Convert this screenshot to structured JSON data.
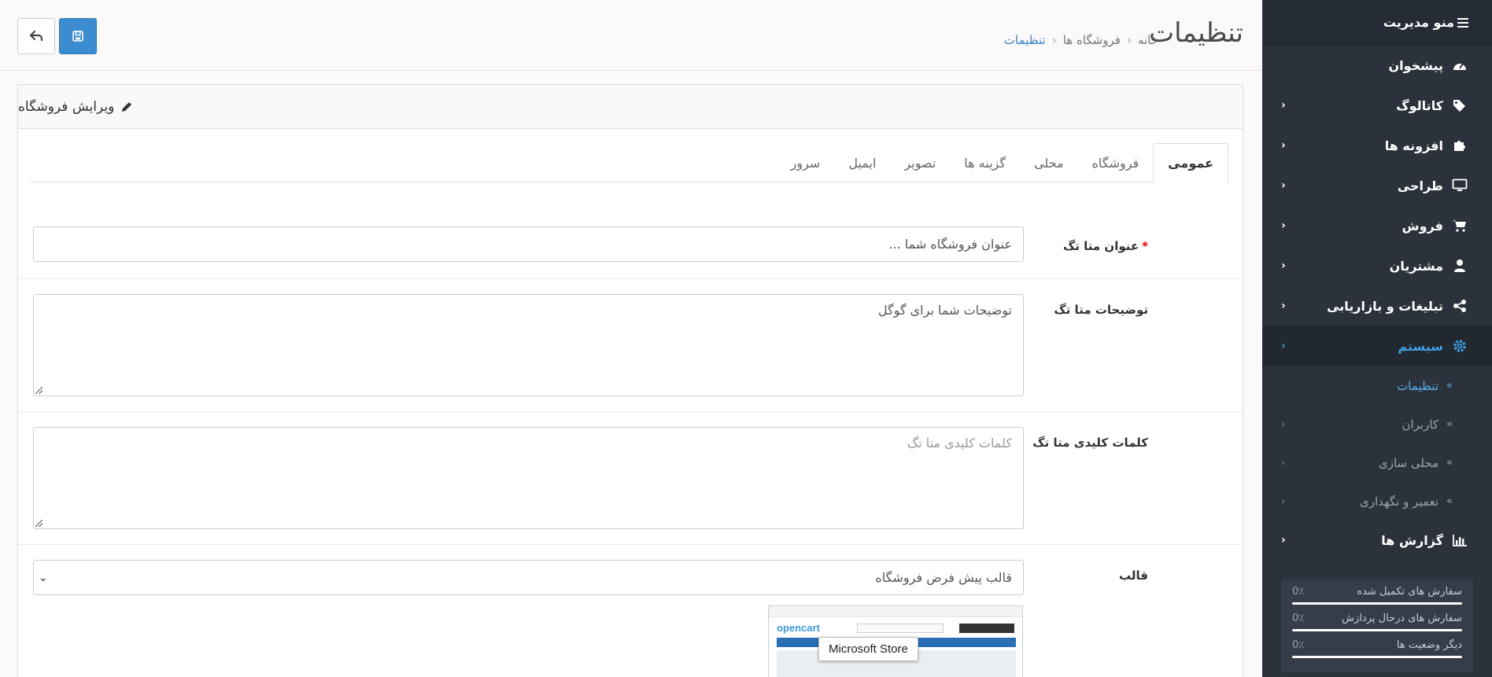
{
  "sidebar": {
    "title": "منو مدیریت",
    "items": [
      {
        "label": "پیشخوان",
        "icon": "dashboard-icon",
        "has_chevron": false
      },
      {
        "label": "کاتالوگ",
        "icon": "tags-icon",
        "has_chevron": true
      },
      {
        "label": "افزونه ها",
        "icon": "puzzle-icon",
        "has_chevron": true
      },
      {
        "label": "طراحی",
        "icon": "desktop-icon",
        "has_chevron": true
      },
      {
        "label": "فروش",
        "icon": "cart-icon",
        "has_chevron": true
      },
      {
        "label": "مشتریان",
        "icon": "user-icon",
        "has_chevron": true
      },
      {
        "label": "تبلیغات و بازاریابی",
        "icon": "share-icon",
        "has_chevron": true
      },
      {
        "label": "سیستم",
        "icon": "gear-icon",
        "has_chevron": true,
        "active": true
      }
    ],
    "subitems": [
      {
        "label": "تنظیمات",
        "active": true
      },
      {
        "label": "کاربران"
      },
      {
        "label": "محلی سازی"
      },
      {
        "label": "تعمیر و نگهداری"
      }
    ],
    "reports": {
      "label": "گزارش ها",
      "icon": "bar-chart-icon"
    },
    "stats": [
      {
        "label": "سفارش های تکمیل شده",
        "percent": "0٪",
        "value": 0
      },
      {
        "label": "سفارش های درحال پردازش",
        "percent": "0٪",
        "value": 0
      },
      {
        "label": "دیگر وضعیت ها",
        "percent": "0٪",
        "value": 0
      }
    ]
  },
  "header": {
    "title": "تنظیمات",
    "breadcrumb": [
      "خانه",
      "فروشگاه ها",
      "تنظیمات"
    ]
  },
  "panel": {
    "title": "ویرایش فروشگاه",
    "tabs": [
      "عمومی",
      "فروشگاه",
      "محلی",
      "گزینه ها",
      "تصویر",
      "ایمیل",
      "سرور"
    ],
    "fields": {
      "meta_title": {
        "label": "عنوان متا تگ",
        "value": "عنوان فروشگاه شما ..."
      },
      "meta_description": {
        "label": "توضیحات متا تگ",
        "value": "توضیحات شما برای گوگل"
      },
      "meta_keywords": {
        "label": "کلمات کلیدی متا تگ",
        "placeholder": "کلمات کلیدی متا تگ"
      },
      "theme": {
        "label": "قالب",
        "value": "قالب پیش فرض فروشگاه"
      }
    },
    "theme_preview_logo": "opencart"
  },
  "tooltip": "Microsoft Store",
  "colors": {
    "sidebar_bg": "#2b323c",
    "accent": "#3c8dd0",
    "link": "#3a83c3",
    "required": "#e3000e"
  }
}
